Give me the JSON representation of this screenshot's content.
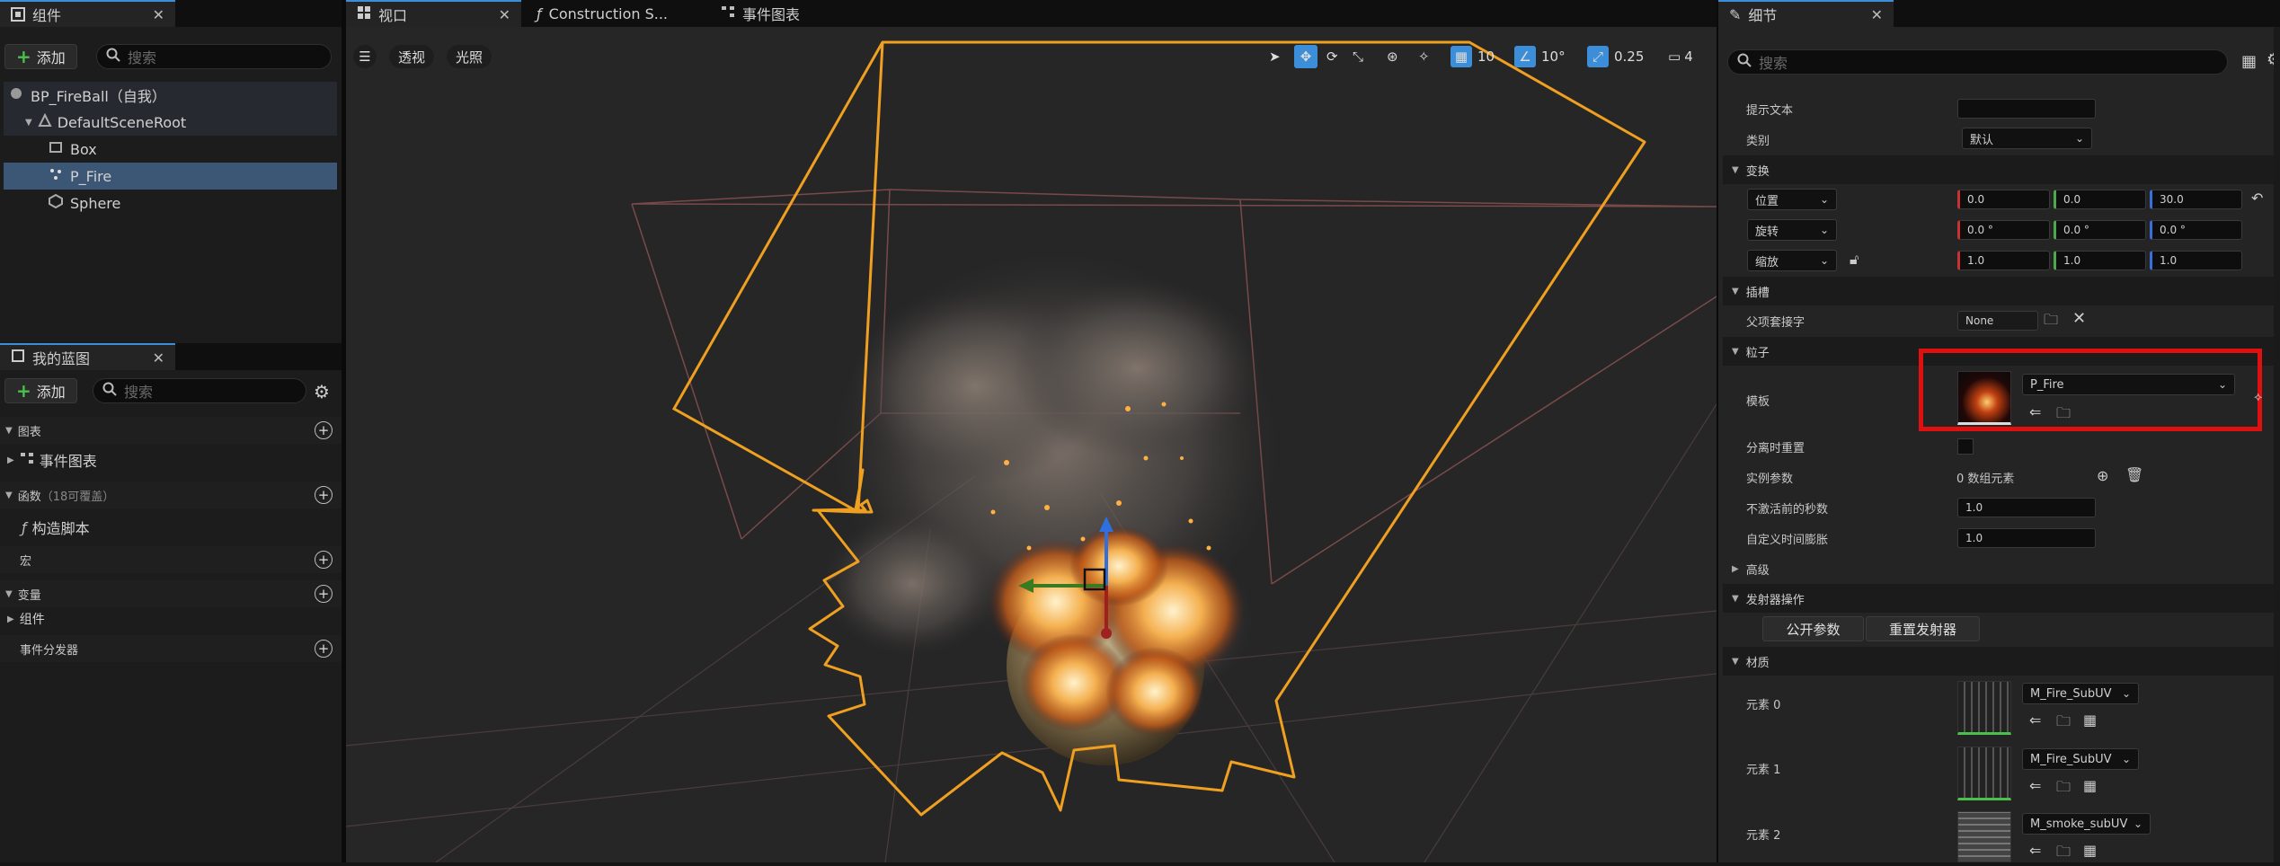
{
  "components_panel": {
    "tab_label": "组件",
    "add_label": "添加",
    "search_placeholder": "搜索",
    "tree": [
      {
        "label": "BP_FireBall（自我）"
      },
      {
        "label": "DefaultSceneRoot"
      },
      {
        "label": "Box"
      },
      {
        "label": "P_Fire"
      },
      {
        "label": "Sphere"
      }
    ]
  },
  "blueprint_panel": {
    "tab_label": "我的蓝图",
    "add_label": "添加",
    "search_placeholder": "搜索",
    "sections": {
      "graphs": "图表",
      "event_graph": "事件图表",
      "functions": "函数",
      "functions_count": "（18可覆盖）",
      "construction_script": "构造脚本",
      "macros": "宏",
      "variables": "变量",
      "components": "组件",
      "event_dispatchers": "事件分发器"
    }
  },
  "editor_tabs": [
    {
      "label": "视口"
    },
    {
      "label": "Construction S..."
    },
    {
      "label": "事件图表"
    }
  ],
  "viewport": {
    "perspective_label": "透视",
    "lighting_label": "光照",
    "grid_snap": "10",
    "rotation_snap": "10°",
    "scale_snap": "0.25",
    "camera_speed": "4"
  },
  "details": {
    "tab_label": "细节",
    "search_placeholder": "搜索",
    "rows": {
      "tooltip_label": "提示文本",
      "category_label": "类别",
      "category_value": "默认",
      "transform_section": "变换",
      "location_label": "位置",
      "location": [
        "0.0",
        "0.0",
        "30.0"
      ],
      "rotation_label": "旋转",
      "rotation": [
        "0.0 °",
        "0.0 °",
        "0.0 °"
      ],
      "scale_label": "缩放",
      "scale": [
        "1.0",
        "1.0",
        "1.0"
      ],
      "sockets_section": "插槽",
      "parent_socket_label": "父项套接字",
      "parent_socket_value": "None",
      "particles_section": "粒子",
      "template_label": "模板",
      "template_value": "P_Fire",
      "reset_on_detach_label": "分离时重置",
      "instance_params_label": "实例参数",
      "instance_params_value": "0 数组元素",
      "seconds_before_inactive_label": "不激活前的秒数",
      "seconds_before_inactive_value": "1.0",
      "custom_time_dilation_label": "自定义时间膨胀",
      "custom_time_dilation_value": "1.0",
      "advanced_section": "高级",
      "emitter_actions_section": "发射器操作",
      "expose_params_button": "公开参数",
      "reset_emitter_button": "重置发射器",
      "materials_section": "材质",
      "materials": [
        {
          "label": "元素 0",
          "value": "M_Fire_SubUV"
        },
        {
          "label": "元素 1",
          "value": "M_Fire_SubUV"
        },
        {
          "label": "元素 2",
          "value": "M_smoke_subUV"
        }
      ]
    }
  },
  "colors": {
    "selection_orange": "#f0a020",
    "highlight_red": "#e01010",
    "accent_blue": "#3d8ed8"
  }
}
